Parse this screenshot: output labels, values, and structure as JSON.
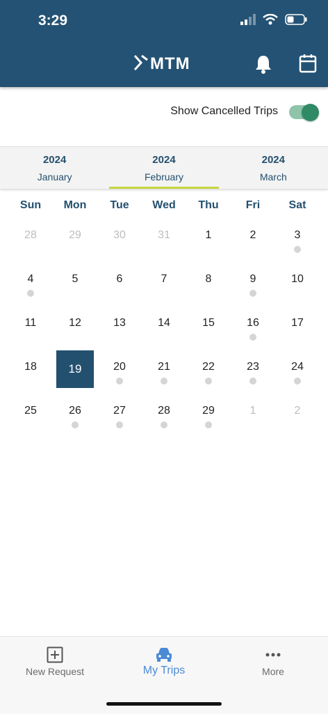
{
  "status_bar": {
    "time": "3:29"
  },
  "header": {
    "logo_text": "MTM"
  },
  "toggle": {
    "label": "Show Cancelled Trips",
    "on": true
  },
  "months": [
    {
      "year": "2024",
      "name": "January",
      "active": false
    },
    {
      "year": "2024",
      "name": "February",
      "active": true
    },
    {
      "year": "2024",
      "name": "March",
      "active": false
    }
  ],
  "calendar": {
    "weekdays": [
      "Sun",
      "Mon",
      "Tue",
      "Wed",
      "Thu",
      "Fri",
      "Sat"
    ],
    "weeks": [
      [
        {
          "d": "28",
          "muted": true,
          "dot": false
        },
        {
          "d": "29",
          "muted": true,
          "dot": false
        },
        {
          "d": "30",
          "muted": true,
          "dot": false
        },
        {
          "d": "31",
          "muted": true,
          "dot": false
        },
        {
          "d": "1",
          "muted": false,
          "dot": false
        },
        {
          "d": "2",
          "muted": false,
          "dot": false
        },
        {
          "d": "3",
          "muted": false,
          "dot": true
        }
      ],
      [
        {
          "d": "4",
          "muted": false,
          "dot": true
        },
        {
          "d": "5",
          "muted": false,
          "dot": false
        },
        {
          "d": "6",
          "muted": false,
          "dot": false
        },
        {
          "d": "7",
          "muted": false,
          "dot": false
        },
        {
          "d": "8",
          "muted": false,
          "dot": false
        },
        {
          "d": "9",
          "muted": false,
          "dot": true
        },
        {
          "d": "10",
          "muted": false,
          "dot": false
        }
      ],
      [
        {
          "d": "11",
          "muted": false,
          "dot": false
        },
        {
          "d": "12",
          "muted": false,
          "dot": false
        },
        {
          "d": "13",
          "muted": false,
          "dot": false
        },
        {
          "d": "14",
          "muted": false,
          "dot": false
        },
        {
          "d": "15",
          "muted": false,
          "dot": false
        },
        {
          "d": "16",
          "muted": false,
          "dot": true
        },
        {
          "d": "17",
          "muted": false,
          "dot": false
        }
      ],
      [
        {
          "d": "18",
          "muted": false,
          "dot": false
        },
        {
          "d": "19",
          "muted": false,
          "dot": false,
          "selected": true
        },
        {
          "d": "20",
          "muted": false,
          "dot": true
        },
        {
          "d": "21",
          "muted": false,
          "dot": true
        },
        {
          "d": "22",
          "muted": false,
          "dot": true
        },
        {
          "d": "23",
          "muted": false,
          "dot": true
        },
        {
          "d": "24",
          "muted": false,
          "dot": true
        }
      ],
      [
        {
          "d": "25",
          "muted": false,
          "dot": false
        },
        {
          "d": "26",
          "muted": false,
          "dot": true
        },
        {
          "d": "27",
          "muted": false,
          "dot": true
        },
        {
          "d": "28",
          "muted": false,
          "dot": true
        },
        {
          "d": "29",
          "muted": false,
          "dot": true
        },
        {
          "d": "1",
          "muted": true,
          "dot": false
        },
        {
          "d": "2",
          "muted": true,
          "dot": false
        }
      ]
    ]
  },
  "bottom_nav": [
    {
      "label": "New Request",
      "icon": "plus-square-icon",
      "active": false
    },
    {
      "label": "My Trips",
      "icon": "car-icon",
      "active": true
    },
    {
      "label": "More",
      "icon": "more-dots-icon",
      "active": false
    }
  ],
  "colors": {
    "primary": "#245274",
    "accent": "#c6d73d",
    "toggle": "#2f8a65",
    "nav_active": "#4a8ad6"
  }
}
